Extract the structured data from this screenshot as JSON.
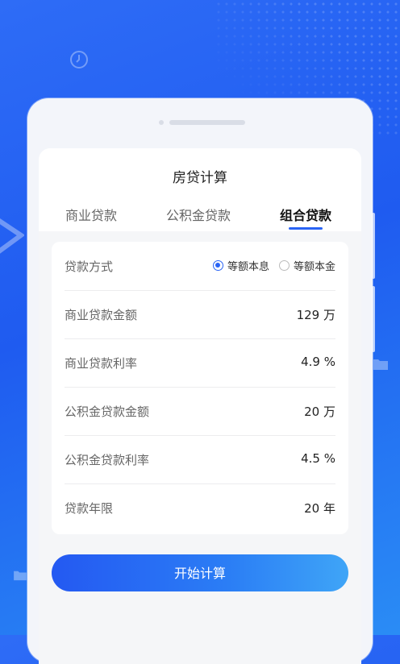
{
  "title": "房贷计算",
  "tabs": [
    {
      "label": "商业贷款"
    },
    {
      "label": "公积金贷款"
    },
    {
      "label": "组合贷款"
    }
  ],
  "form": {
    "repayment_label": "贷款方式",
    "repayment_options": [
      {
        "label": "等额本息",
        "checked": true
      },
      {
        "label": "等额本金",
        "checked": false
      }
    ],
    "rows": [
      {
        "label": "商业贷款金额",
        "value": "129 万"
      },
      {
        "label": "商业贷款利率",
        "value": "4.9 %"
      },
      {
        "label": "公积金贷款金额",
        "value": "20 万"
      },
      {
        "label": "公积金贷款利率",
        "value": "4.5 %"
      },
      {
        "label": "贷款年限",
        "value": "20 年"
      }
    ]
  },
  "action": {
    "label": "开始计算"
  },
  "colors": {
    "accent": "#2a64f5",
    "background": "#1f5bf0"
  },
  "icons": [
    "clock-icon",
    "folder-icon",
    "radio-checked-icon",
    "radio-unchecked-icon"
  ]
}
